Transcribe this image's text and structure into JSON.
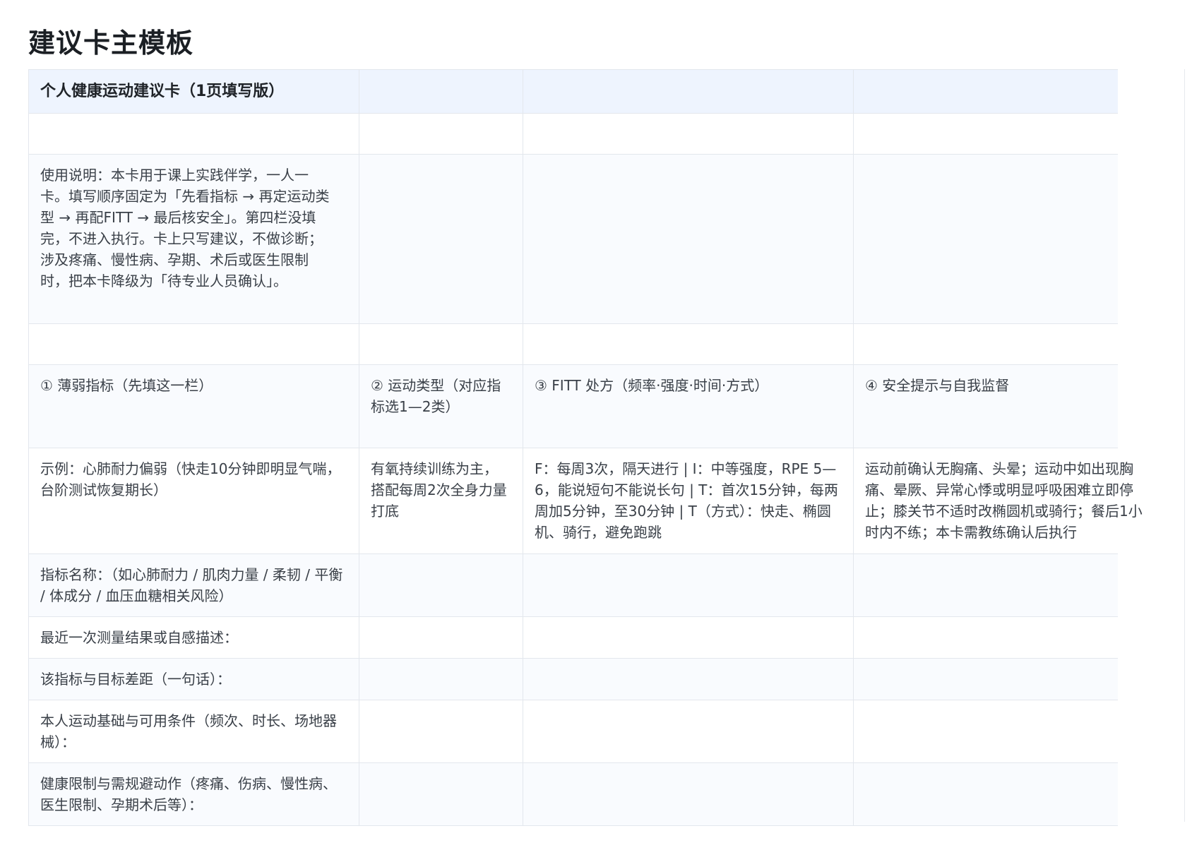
{
  "page": {
    "title": "建议卡主模板"
  },
  "card": {
    "header": "个人健康运动建议卡（1页填写版）",
    "instructions": "使用说明：本卡用于课上实践伴学，一人一卡。填写顺序固定为「先看指标 → 再定运动类型 → 再配FITT → 最后核安全」。第四栏没填完，不进入执行。卡上只写建议，不做诊断；涉及疼痛、慢性病、孕期、术后或医生限制时，把本卡降级为「待专业人员确认」。",
    "columns": [
      "① 薄弱指标（先填这一栏）",
      "② 运动类型（对应指标选1—2类）",
      "③ FITT 处方（频率·强度·时间·方式）",
      "④ 安全提示与自我监督"
    ],
    "example": {
      "indicator": "示例：心肺耐力偏弱（快走10分钟即明显气喘，台阶测试恢复期长）",
      "type": "有氧持续训练为主，搭配每周2次全身力量打底",
      "fitt": "F：每周3次，隔天进行 | I：中等强度，RPE 5—6，能说短句不能说长句 | T：首次15分钟，每两周加5分钟，至30分钟 | T（方式）：快走、椭圆机、骑行，避免跑跳",
      "safety": "运动前确认无胸痛、头晕；运动中如出现胸痛、晕厥、异常心悸或明显呼吸困难立即停止；膝关节不适时改椭圆机或骑行；餐后1小时内不练；本卡需教练确认后执行"
    },
    "fields": [
      "指标名称：（如心肺耐力 / 肌肉力量 / 柔韧 / 平衡 / 体成分 / 血压血糖相关风险）",
      "最近一次测量结果或自感描述：",
      "该指标与目标差距（一句话）：",
      "本人运动基础与可用条件（频次、时长、场地器械）：",
      "健康限制与需规避动作（疼痛、伤病、慢性病、医生限制、孕期术后等）："
    ]
  }
}
